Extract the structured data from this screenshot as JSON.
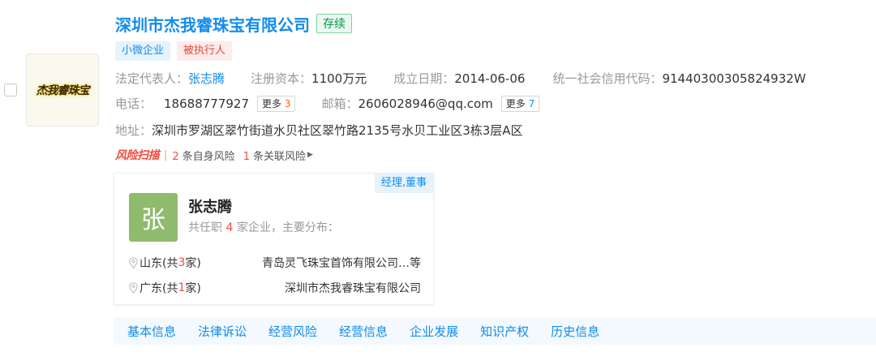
{
  "company": {
    "name": "深圳市杰我睿珠宝有限公司",
    "status": "存续",
    "logo_text": "杰我睿珠宝",
    "tags": [
      "小微企业",
      "被执行人"
    ]
  },
  "info": {
    "legal_rep_label": "法定代表人：",
    "legal_rep": "张志腾",
    "capital_label": "注册资本：",
    "capital": "1100万元",
    "founded_label": "成立日期：",
    "founded": "2014-06-06",
    "credit_code_label": "统一社会信用代码：",
    "credit_code": "91440300305824932W",
    "phone_label": "电话：",
    "phone": "18688777927",
    "phone_more_label": "更多",
    "phone_more_count": "3",
    "email_label": "邮箱：",
    "email": "2606028946@qq.com",
    "email_more_label": "更多",
    "email_more_count": "7",
    "address_label": "地址：",
    "address": "深圳市罗湖区翠竹街道水贝社区翠竹路2135号水贝工业区3栋3层A区"
  },
  "risk": {
    "logo": "风险扫描",
    "separator": "|",
    "self_count": "2",
    "self_label": "条自身风险",
    "related_count": "1",
    "related_label": "条关联风险"
  },
  "person": {
    "role": "经理,董事",
    "avatar_char": "张",
    "name": "张志腾",
    "desc_prefix": "共任职",
    "desc_count": "4",
    "desc_suffix": "家企业，主要分布：",
    "distribution": [
      {
        "region": "山东",
        "count": "3",
        "company": "青岛灵飞珠宝首饰有限公司…等"
      },
      {
        "region": "广东",
        "count": "1",
        "company": "深圳市杰我睿珠宝有限公司"
      }
    ]
  },
  "tabs": [
    "基本信息",
    "法律诉讼",
    "经营风险",
    "经营信息",
    "企业发展",
    "知识产权",
    "历史信息"
  ],
  "colors": {
    "primary": "#128bed",
    "status_green": "#009944",
    "risk_red": "#ef4b3f",
    "avatar_bg": "#8fbb6e"
  }
}
